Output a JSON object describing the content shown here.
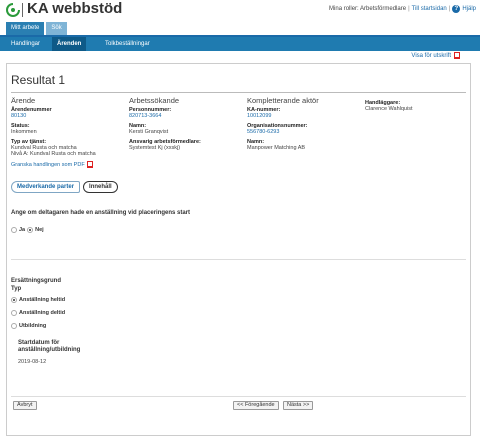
{
  "header": {
    "app_title": "KA webbstöd",
    "roles_text": "Mina roller: Arbetsförmedlare",
    "start_link": "Till startsidan",
    "help_label": "Hjälp",
    "help_icon": "?",
    "logo_icon": "ka-logo-icon"
  },
  "top_tabs": [
    {
      "label": "Mitt arbete",
      "active": true
    },
    {
      "label": "Sök",
      "active": false
    }
  ],
  "nav": {
    "items": [
      {
        "label": "Handlingar",
        "active": false
      },
      {
        "label": "Ärenden",
        "active": true
      },
      {
        "label": "Tolkbeställningar",
        "active": false
      }
    ]
  },
  "print_link": "Visa för utskrift",
  "page_title": "Resultat 1",
  "arende": {
    "heading": "Ärende",
    "number_label": "Ärendenummer",
    "number_value": "80130",
    "status_label": "Status:",
    "status_value": "Inkommen",
    "type_label": "Typ av tjänst:",
    "type_value_1": "Kundval Rusta och matcha",
    "type_value_2": "Nivå A: Kundval Rusta och matcha",
    "review_link": "Granska handlingen som PDF"
  },
  "arbetssokande": {
    "heading": "Arbetssökande",
    "person_label": "Personnummer:",
    "person_value": "820713-3664",
    "name_label": "Namn:",
    "name_value": "Kersti Granqvist",
    "responsible_label": "Ansvarig arbetsförmedlare:",
    "responsible_value": "Systemtest Kj (xxskj)"
  },
  "aktor": {
    "heading": "Kompletterande aktör",
    "ka_label": "KA-nummer:",
    "ka_value": "10012099",
    "org_label": "Organisationsnummer:",
    "org_value": "556780-6293",
    "name_label": "Namn:",
    "name_value": "Manpower Matching AB"
  },
  "handlaggare": {
    "label": "Handläggare:",
    "value": "Clarence Wahlquist"
  },
  "tabs": {
    "partner": "Medverkande parter",
    "content": "Innehåll"
  },
  "question": {
    "text": "Ange om deltagaren hade en anställning vid placeringens start",
    "yes": "Ja",
    "no": "Nej",
    "selected": "no"
  },
  "compensation": {
    "title": "Ersättningsgrund",
    "sub": "Typ",
    "options": [
      "Anställning heltid",
      "Anställning deltid",
      "Utbildning"
    ],
    "selected_index": 0
  },
  "start_date": {
    "label": "Startdatum för anställning/utbildning",
    "value": "2019-08-12"
  },
  "buttons": {
    "cancel": "Avbryt",
    "previous": "<< Föregående",
    "next": "Nästa >>"
  },
  "colors": {
    "accent": "#1f7bb0",
    "link": "#1a6aa8",
    "pdf_red": "#dd2222"
  }
}
